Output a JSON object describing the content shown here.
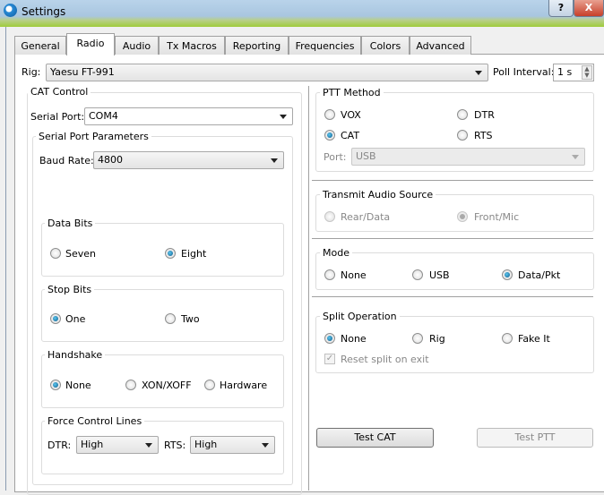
{
  "window": {
    "title": "Settings",
    "help": "?",
    "close": "X"
  },
  "tabs": [
    "General",
    "Radio",
    "Audio",
    "Tx Macros",
    "Reporting",
    "Frequencies",
    "Colors",
    "Advanced"
  ],
  "rig": {
    "label": "Rig:",
    "value": "Yaesu FT-991",
    "poll_label": "Poll Interval:",
    "poll_value": "1 s"
  },
  "cat": {
    "title": "CAT Control",
    "serial_label": "Serial Port:",
    "serial_value": "COM4",
    "params_title": "Serial Port Parameters",
    "baud_label": "Baud Rate:",
    "baud_value": "4800",
    "data_bits": {
      "title": "Data Bits",
      "options": [
        "Seven",
        "Eight"
      ]
    },
    "stop_bits": {
      "title": "Stop Bits",
      "options": [
        "One",
        "Two"
      ]
    },
    "handshake": {
      "title": "Handshake",
      "options": [
        "None",
        "XON/XOFF",
        "Hardware"
      ]
    },
    "force": {
      "title": "Force Control Lines",
      "dtr_label": "DTR:",
      "dtr_value": "High",
      "rts_label": "RTS:",
      "rts_value": "High"
    }
  },
  "ptt": {
    "title": "PTT Method",
    "options": [
      "VOX",
      "DTR",
      "CAT",
      "RTS"
    ],
    "port_label": "Port:",
    "port_value": "USB"
  },
  "audio": {
    "title": "Transmit Audio Source",
    "options": [
      "Rear/Data",
      "Front/Mic"
    ]
  },
  "mode": {
    "title": "Mode",
    "options": [
      "None",
      "USB",
      "Data/Pkt"
    ]
  },
  "split": {
    "title": "Split Operation",
    "options": [
      "None",
      "Rig",
      "Fake It"
    ],
    "reset": "Reset split on exit"
  },
  "buttons": {
    "test_cat": "Test CAT",
    "test_ptt": "Test PTT"
  }
}
